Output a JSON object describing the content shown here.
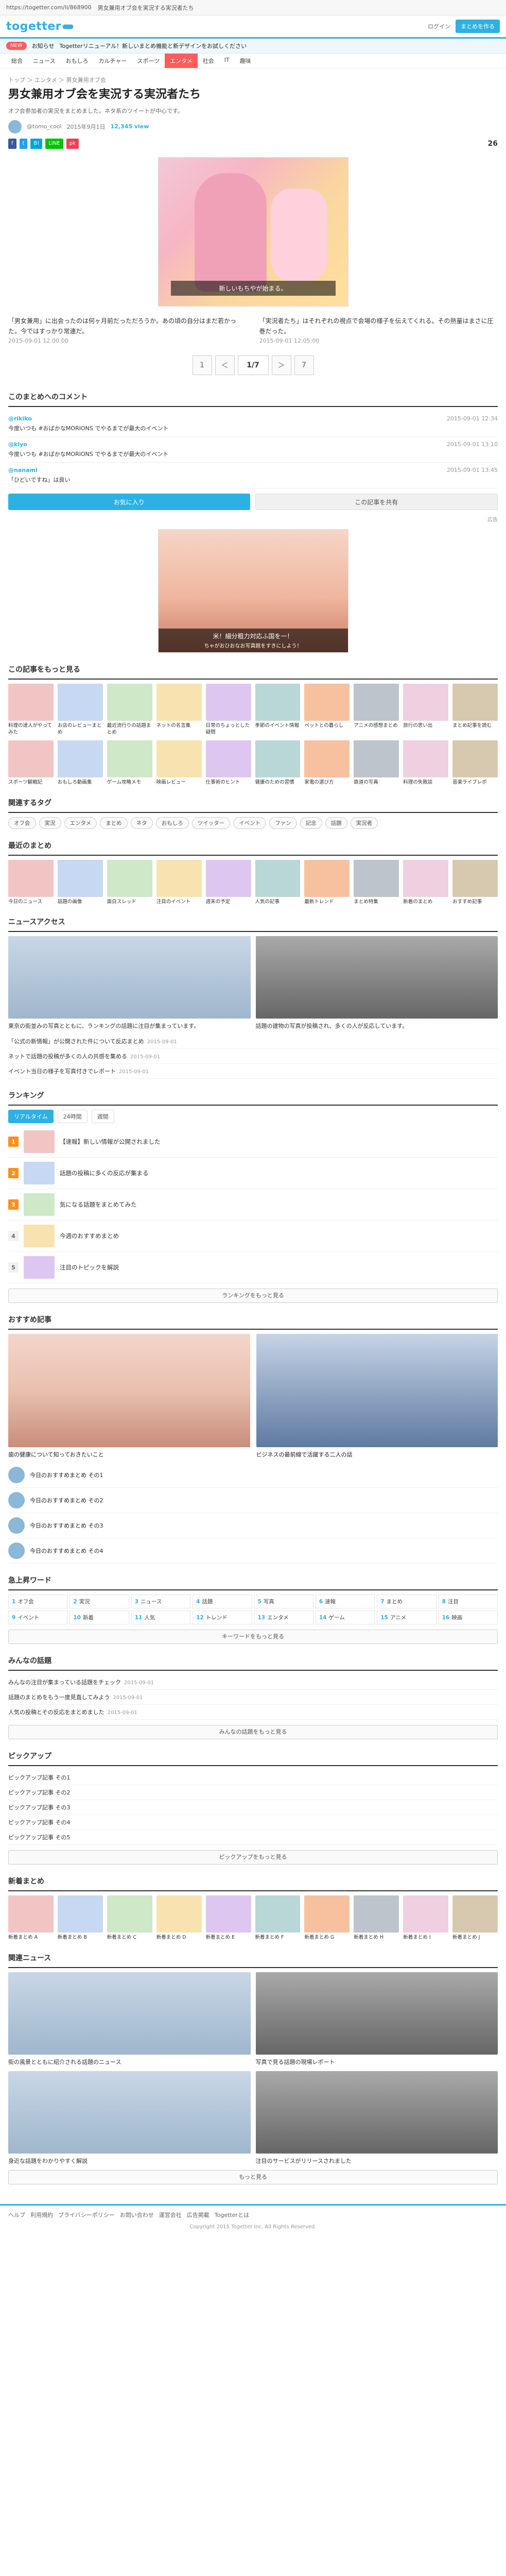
{
  "browser": {
    "url": "https://togetter.com/li/868900",
    "tab_title": "男女兼用オブ会を実況する実況者たち"
  },
  "header": {
    "logo": "togetter",
    "login": "ログイン",
    "cta": "まとめを作る"
  },
  "subnav": {
    "notice": "お知らせ",
    "text": "Togetterリニューアル！新しいまとめ機能と新デザインをお試しください",
    "badge": "NEW"
  },
  "categories": [
    "総合",
    "ニュース",
    "おもしろ",
    "カルチャー",
    "スポーツ",
    "エンタメ",
    "社会",
    "IT",
    "趣味"
  ],
  "active_category": "エンタメ",
  "breadcrumb": "トップ ＞ エンタメ ＞ 男女兼用オブ会",
  "title": "男女兼用オブ会を実況する実況者たち",
  "description": "オフ会参加者の実況をまとめました。ネタ系のツイートが中心です。",
  "meta": {
    "author": "@tomo_cool",
    "date": "2015年9月1日",
    "views": "12,345 view",
    "favorites": "26"
  },
  "share": {
    "facebook": "f",
    "twitter": "t",
    "hatena": "B!",
    "line": "LINE",
    "pocket": "pk"
  },
  "hero": {
    "caption": "新しいもちやが始まる。"
  },
  "paragraphs": [
    {
      "text": "「男女兼用」に出会ったのは何ヶ月前だっただろうか。あの頃の自分はまだ若かった。今ではすっかり常連だ。",
      "source": "2015-09-01 12:00:00"
    },
    {
      "text": "「実況者たち」はそれぞれの視点で会場の様子を伝えてくれる。その熱量はまさに圧巻だった。",
      "source": "2015-09-01 12:05:00"
    }
  ],
  "pager": {
    "prev": "＜",
    "current": "1/7",
    "next": "＞",
    "first": "1",
    "last": "7"
  },
  "comments_section": {
    "title": "このまとめへのコメント",
    "comments": [
      {
        "who": "@rikiko",
        "time": "2015-09-01 12:34",
        "text": "今度いつも #おばかなMORIONS でやるまでが最大のイベント"
      },
      {
        "who": "@kiyo",
        "time": "2015-09-01 13:10",
        "text": "今度いつも #おばかなMORIONS でやるまでが最大のイベント"
      },
      {
        "who": "@nanami",
        "time": "2015-09-01 13:45",
        "text": "「ひどいですね」は良い"
      }
    ]
  },
  "actions": {
    "favorite": "お気に入り",
    "new_note": "この記事を共有"
  },
  "ad": {
    "label": "広告",
    "pitch": "米！細分粗力対応ふ国を一！",
    "sub": "ちゃがおひおなお写真館をすきにしよう！"
  },
  "related_title": "この記事をもっと見る",
  "related_cards": [
    "料理の達人がやってみた",
    "お店のレビューまとめ",
    "最近流行りの話題まとめ",
    "ネットの名言集",
    "日常のちょっとした疑問",
    "季節のイベント情報",
    "ペットとの暮らし",
    "アニメの感想まとめ",
    "旅行の思い出",
    "まとめ記事を読む"
  ],
  "related_cards_2": [
    "スポーツ観戦記",
    "おもしろ動画集",
    "ゲーム攻略メモ",
    "映画レビュー",
    "仕事術のヒント",
    "健康のための習慣",
    "家電の選び方",
    "鉄道の写真",
    "料理の失敗談",
    "音楽ライブレポ"
  ],
  "tags_title": "関連するタグ",
  "tags": [
    "オフ会",
    "実況",
    "エンタメ",
    "まとめ",
    "ネタ",
    "おもしろ",
    "ツイッター",
    "イベント",
    "ファン",
    "記念",
    "話題",
    "実況者"
  ],
  "popular_title": "最近のまとめ",
  "popular_cards": [
    "今日のニュース",
    "話題の画像",
    "面白スレッド",
    "注目のイベント",
    "週末の予定",
    "人気の記事",
    "最新トレンド",
    "まとめ特集",
    "新着のまとめ",
    "おすすめ記事"
  ],
  "news_title": "ニュースアクセス",
  "news_big": [
    {
      "cap": "東京の街並みの写真とともに、ランキングの話題に注目が集まっています。"
    },
    {
      "cap": "話題の建物の写真が投稿され、多くの人が反応しています。"
    }
  ],
  "news_list": [
    {
      "text": "「公式の新情報」が公開された件について反応まとめ",
      "src": "2015-09-01"
    },
    {
      "text": "ネットで話題の投稿が多くの人の共感を集める",
      "src": "2015-09-01"
    },
    {
      "text": "イベント当日の様子を写真付きでレポート",
      "src": "2015-09-01"
    }
  ],
  "ranking_title": "ランキング",
  "ranking_tabs": [
    "リアルタイム",
    "24時間",
    "週間"
  ],
  "ranking": [
    {
      "n": "1",
      "text": "【速報】新しい情報が公開されました"
    },
    {
      "n": "2",
      "text": "話題の投稿に多くの反応が集まる"
    },
    {
      "n": "3",
      "text": "気になる話題をまとめてみた"
    },
    {
      "n": "4",
      "text": "今週のおすすめまとめ"
    },
    {
      "n": "5",
      "text": "注目のトピックを解説"
    }
  ],
  "ranking_more": "ランキングをもっと見る",
  "reco_title": "おすすめ記事",
  "reco_big": [
    {
      "cap": "歯の健康について知っておきたいこと"
    },
    {
      "cap": "ビジネスの最前線で活躍する二人の話"
    }
  ],
  "reco_list": [
    "今日のおすすめまとめ その1",
    "今日のおすすめまとめ その2",
    "今日のおすすめまとめ その3",
    "今日のおすすめまとめ その4"
  ],
  "kw_title": "急上昇ワード",
  "keywords": [
    "オフ会",
    "実況",
    "ニュース",
    "話題",
    "写真",
    "速報",
    "まとめ",
    "注目",
    "イベント",
    "新着",
    "人気",
    "トレンド",
    "エンタメ",
    "ゲーム",
    "アニメ",
    "映画"
  ],
  "kw_more": "キーワードをもっと見る",
  "community_title": "みんなの話題",
  "community": [
    {
      "text": "みんなの注目が集まっている話題をチェック",
      "src": "2015-09-01"
    },
    {
      "text": "話題のまとめをもう一度見直してみよう",
      "src": "2015-09-01"
    },
    {
      "text": "人気の投稿とその反応をまとめました",
      "src": "2015-09-01"
    }
  ],
  "community_more": "みんなの話題をもっと見る",
  "feature_title": "ピックアップ",
  "feature_list": [
    "ピックアップ記事 その1",
    "ピックアップ記事 その2",
    "ピックアップ記事 その3",
    "ピックアップ記事 その4",
    "ピックアップ記事 その5"
  ],
  "feature_more": "ピックアップをもっと見る",
  "latest_title": "新着まとめ",
  "latest_cards": [
    "新着まとめ A",
    "新着まとめ B",
    "新着まとめ C",
    "新着まとめ D",
    "新着まとめ E",
    "新着まとめ F",
    "新着まとめ G",
    "新着まとめ H",
    "新着まとめ I",
    "新着まとめ J"
  ],
  "bottom_news_title": "関連ニュース",
  "bottom_news": [
    {
      "cap": "街の風景とともに紹介される話題のニュース"
    },
    {
      "cap": "写真で見る話題の現場レポート"
    },
    {
      "cap": "身近な話題をわかりやすく解説"
    },
    {
      "cap": "注目のサービスがリリースされました"
    }
  ],
  "bottom_more": "もっと見る",
  "footer": {
    "links": [
      "ヘルプ",
      "利用規約",
      "プライバシーポリシー",
      "お問い合わせ",
      "運営会社",
      "広告掲載",
      "Togetterとは"
    ],
    "copy": "Copyright 2015 Togetter Inc. All Rights Reserved."
  },
  "colors": {
    "brand": "#2db1e3",
    "accent": "#ff5c5c"
  }
}
